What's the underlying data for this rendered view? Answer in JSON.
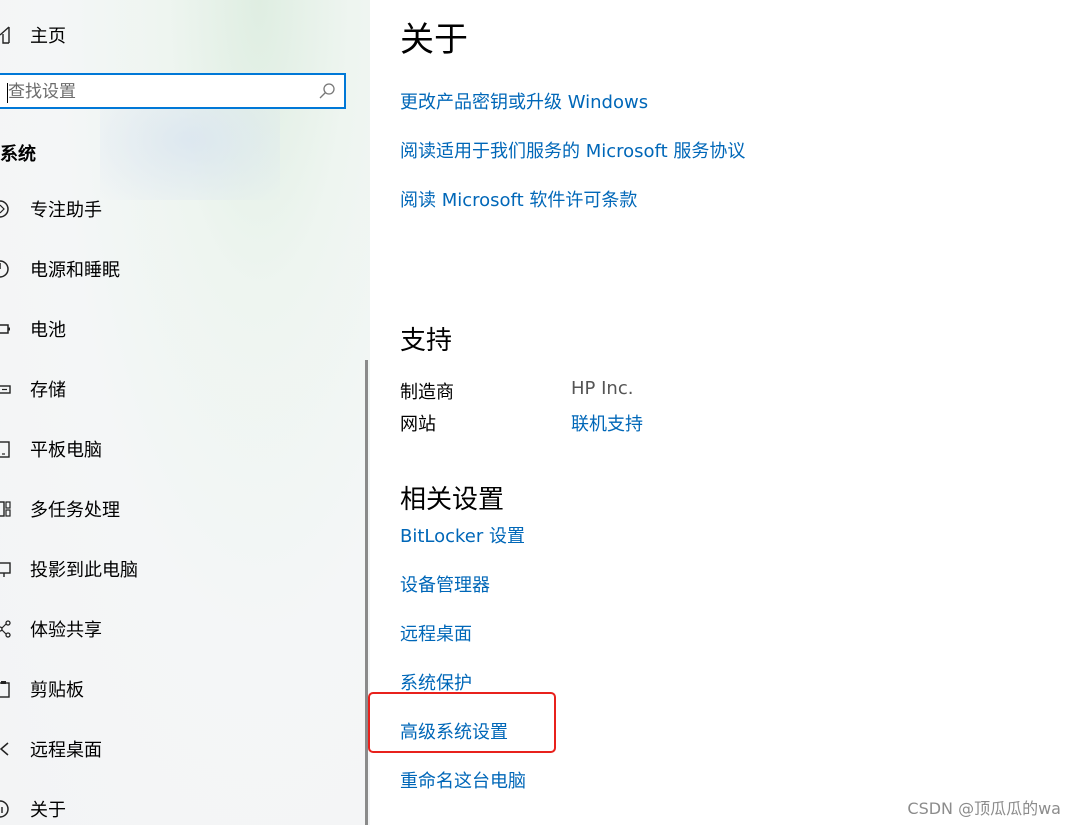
{
  "sidebar": {
    "home": {
      "icon": "home-icon",
      "label": "主页"
    },
    "search": {
      "placeholder": "查找设置",
      "icon": "search-icon"
    },
    "section_heading": "系统",
    "items": [
      {
        "icon": "focus-assist-icon",
        "label": "专注助手"
      },
      {
        "icon": "power-sleep-icon",
        "label": "电源和睡眠"
      },
      {
        "icon": "battery-icon",
        "label": "电池"
      },
      {
        "icon": "storage-icon",
        "label": "存储"
      },
      {
        "icon": "tablet-icon",
        "label": "平板电脑"
      },
      {
        "icon": "multitasking-icon",
        "label": "多任务处理"
      },
      {
        "icon": "project-icon",
        "label": "投影到此电脑"
      },
      {
        "icon": "share-icon",
        "label": "体验共享"
      },
      {
        "icon": "clipboard-icon",
        "label": "剪贴板"
      },
      {
        "icon": "remote-desktop-icon",
        "label": "远程桌面"
      },
      {
        "icon": "about-icon",
        "label": "关于"
      }
    ]
  },
  "main": {
    "title": "关于",
    "top_links": [
      "更改产品密钥或升级 Windows",
      "阅读适用于我们服务的 Microsoft 服务协议",
      "阅读 Microsoft 软件许可条款"
    ],
    "support": {
      "heading": "支持",
      "manufacturer_label": "制造商",
      "manufacturer_value": "HP Inc.",
      "website_label": "网站",
      "website_link": "联机支持"
    },
    "related": {
      "heading": "相关设置",
      "links": [
        "BitLocker 设置",
        "设备管理器",
        "远程桌面",
        "系统保护",
        "高级系统设置",
        "重命名这台电脑"
      ]
    },
    "highlight_color": "#e8211c",
    "link_color": "#0067b8"
  },
  "watermark": "CSDN @顶瓜瓜的wa"
}
